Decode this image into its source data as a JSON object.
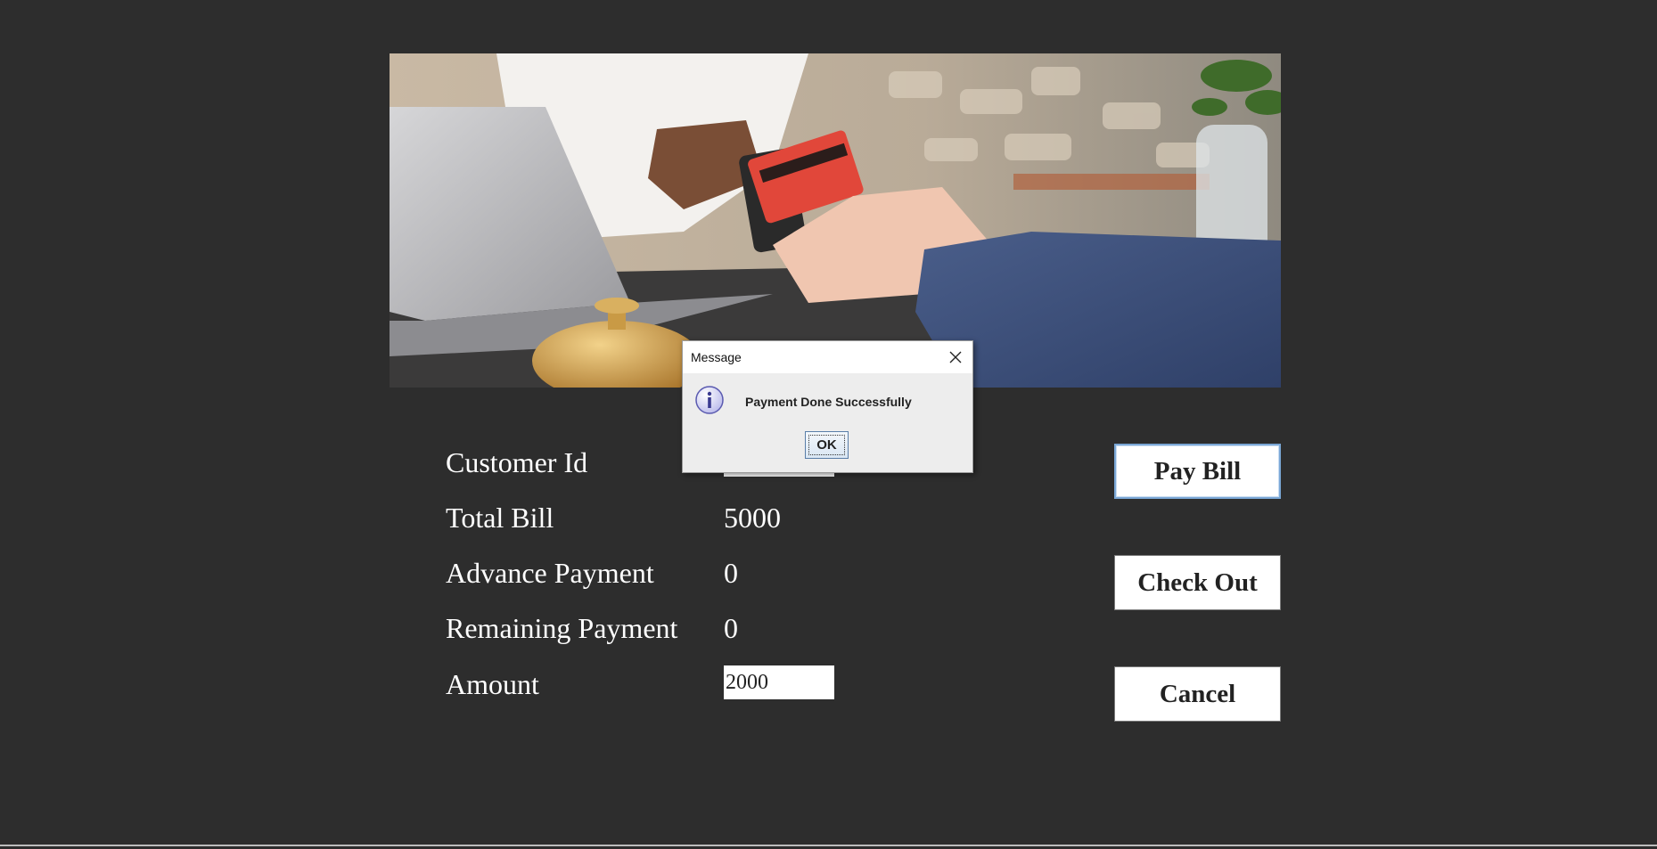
{
  "form": {
    "customer_id_label": "Customer Id",
    "customer_id_value": "",
    "total_bill_label": "Total Bill",
    "total_bill_value": "5000",
    "advance_payment_label": "Advance Payment",
    "advance_payment_value": "0",
    "remaining_payment_label": "Remaining Payment",
    "remaining_payment_value": "0",
    "amount_label": "Amount",
    "amount_value": "2000"
  },
  "buttons": {
    "pay_bill": "Pay Bill",
    "check_out": "Check Out",
    "cancel": "Cancel"
  },
  "dialog": {
    "title": "Message",
    "message": "Payment Done Successfully",
    "ok_label": "OK",
    "icon": "info-icon",
    "close_icon": "close-icon"
  },
  "colors": {
    "background": "#2d2d2d",
    "text": "#ffffff",
    "button_bg": "#ffffff",
    "focus_border": "#7aa7d6"
  }
}
